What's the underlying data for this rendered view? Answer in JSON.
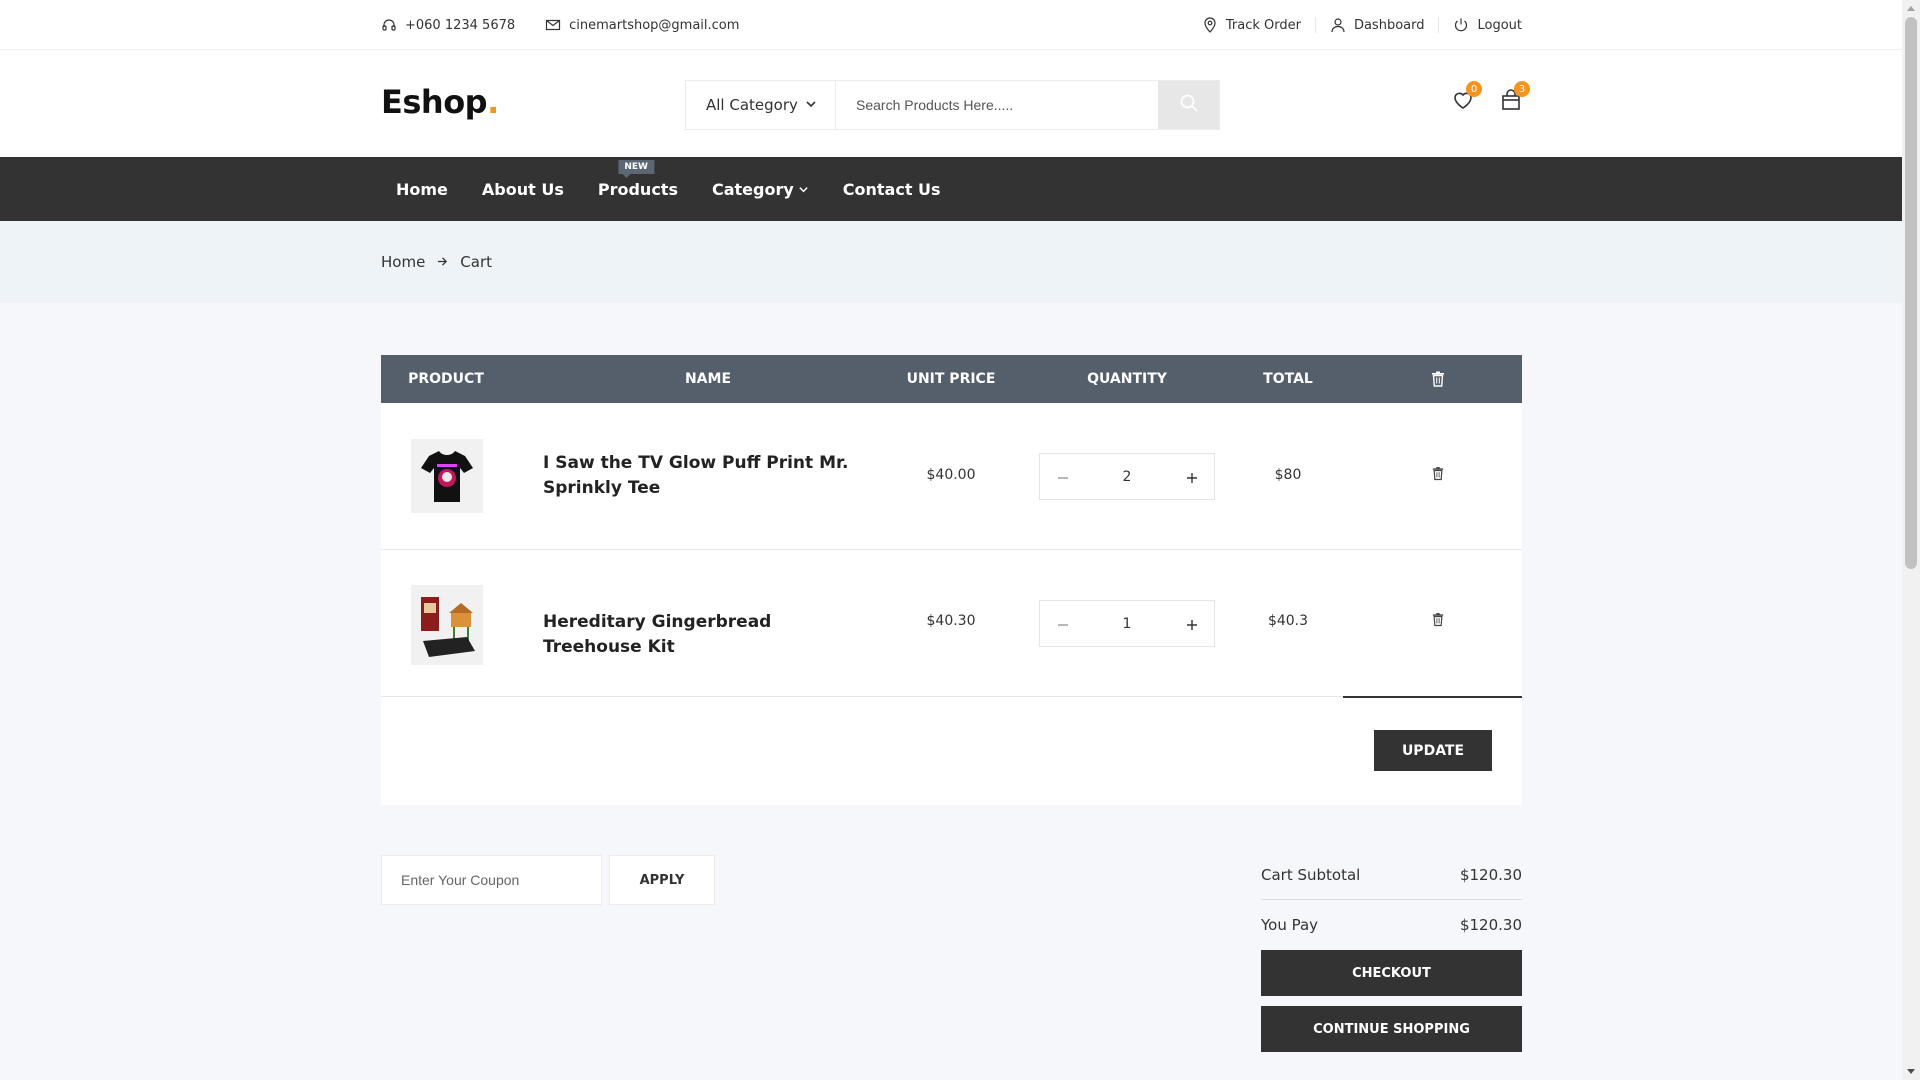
{
  "topbar": {
    "phone": "+060 1234 5678",
    "email": "cinemartshop@gmail.com",
    "track_order": "Track Order",
    "dashboard": "Dashboard",
    "logout": "Logout"
  },
  "header": {
    "logo": "Eshop",
    "logo_dot": ".",
    "category_select": "All Category",
    "search_placeholder": "Search Products Here.....",
    "wishlist_count": "0",
    "cart_count": "3"
  },
  "nav": {
    "items": [
      {
        "label": "Home"
      },
      {
        "label": "About Us"
      },
      {
        "label": "Products",
        "tag": "NEW"
      },
      {
        "label": "Category"
      },
      {
        "label": "Contact Us"
      }
    ]
  },
  "breadcrumb": {
    "home": "Home",
    "current": "Cart"
  },
  "cart": {
    "headers": {
      "product": "PRODUCT",
      "name": "NAME",
      "unit_price": "UNIT PRICE",
      "quantity": "QUANTITY",
      "total": "TOTAL"
    },
    "rows": [
      {
        "name": "I Saw the TV Glow Puff Print Mr. Sprinkly Tee",
        "unit_price": "$40.00",
        "quantity": "2",
        "total": "$80"
      },
      {
        "name": "Hereditary Gingerbread Treehouse Kit",
        "unit_price": "$40.30",
        "quantity": "1",
        "total": "$40.3"
      }
    ],
    "update_label": "UPDATE"
  },
  "coupon": {
    "placeholder": "Enter Your Coupon",
    "apply_label": "APPLY"
  },
  "totals": {
    "subtotal_label": "Cart Subtotal",
    "subtotal_value": "$120.30",
    "you_pay_label": "You Pay",
    "you_pay_value": "$120.30",
    "checkout_label": "CHECKOUT",
    "continue_label": "CONTINUE SHOPPING"
  },
  "colors": {
    "accent": "#f7941d",
    "nav_bg": "#333333",
    "table_header": "#555f6c",
    "breadcrumb_bg": "#eef3f7"
  }
}
